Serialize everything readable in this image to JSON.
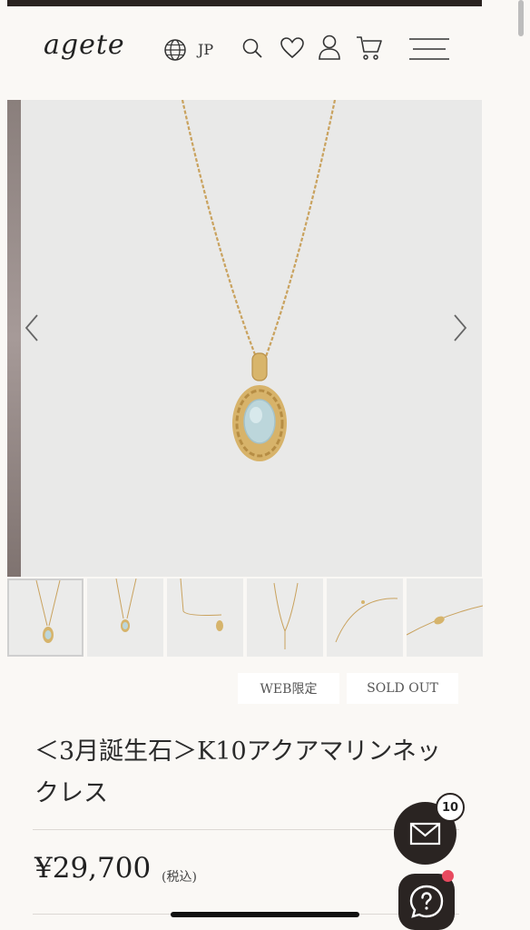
{
  "header": {
    "logo": "agete",
    "region": "JP",
    "icons": [
      "globe-icon",
      "search-icon",
      "heart-icon",
      "account-icon",
      "cart-icon",
      "menu-icon"
    ]
  },
  "gallery": {
    "thumbnail_count": 6
  },
  "badges": {
    "web_only": "WEB限定",
    "sold_out": "SOLD OUT"
  },
  "product": {
    "title": "＜3月誕生石＞K10アクアマリンネックレス",
    "price": "¥29,700",
    "tax_note": "(税込)"
  },
  "floating": {
    "message_count": "10"
  },
  "colors": {
    "accent_dark": "#2a2422",
    "notification_red": "#e84a5f",
    "background": "#faf8f5"
  }
}
